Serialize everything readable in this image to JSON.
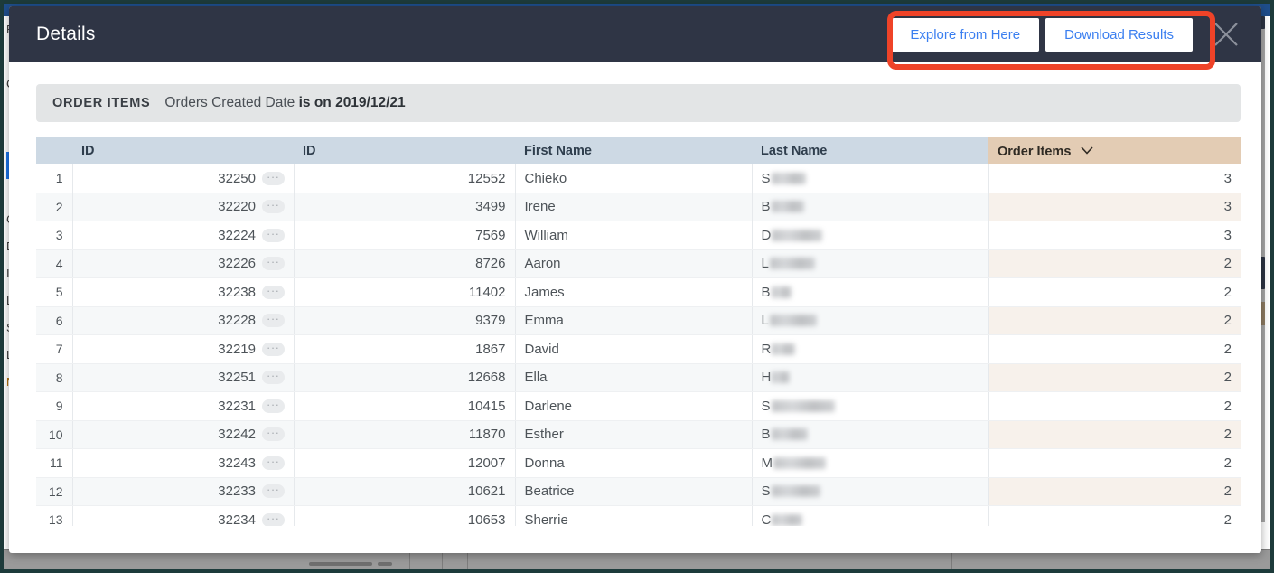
{
  "modal": {
    "title": "Details",
    "buttons": {
      "explore": "Explore from Here",
      "download": "Download Results"
    },
    "close_icon": "close-icon"
  },
  "filter": {
    "view_label": "ORDER ITEMS",
    "expression_prefix": "Orders Created Date ",
    "expression_value": "is on 2019/12/21"
  },
  "table": {
    "columns": [
      {
        "label": "",
        "key": "rownum"
      },
      {
        "label": "ID",
        "key": "order_id"
      },
      {
        "label": "ID",
        "key": "user_id"
      },
      {
        "label": "First Name",
        "key": "first_name"
      },
      {
        "label": "Last Name",
        "key": "last_name"
      },
      {
        "label": "Order Items",
        "key": "order_items",
        "sorted": true,
        "sort_icon": "chevron-down-icon"
      }
    ],
    "dots_label": "···",
    "rows": [
      {
        "rownum": "1",
        "order_id": "32250",
        "user_id": "12552",
        "first_name": "Chieko",
        "last_name_initial": "S",
        "redact_width": 38,
        "order_items": "3"
      },
      {
        "rownum": "2",
        "order_id": "32220",
        "user_id": "3499",
        "first_name": "Irene",
        "last_name_initial": "B",
        "redact_width": 36,
        "order_items": "3"
      },
      {
        "rownum": "3",
        "order_id": "32224",
        "user_id": "7569",
        "first_name": "William",
        "last_name_initial": "D",
        "redact_width": 56,
        "order_items": "3"
      },
      {
        "rownum": "4",
        "order_id": "32226",
        "user_id": "8726",
        "first_name": "Aaron",
        "last_name_initial": "L",
        "redact_width": 50,
        "order_items": "2"
      },
      {
        "rownum": "5",
        "order_id": "32238",
        "user_id": "11402",
        "first_name": "James",
        "last_name_initial": "B",
        "redact_width": 22,
        "order_items": "2"
      },
      {
        "rownum": "6",
        "order_id": "32228",
        "user_id": "9379",
        "first_name": "Emma",
        "last_name_initial": "L",
        "redact_width": 52,
        "order_items": "2"
      },
      {
        "rownum": "7",
        "order_id": "32219",
        "user_id": "1867",
        "first_name": "David",
        "last_name_initial": "R",
        "redact_width": 26,
        "order_items": "2"
      },
      {
        "rownum": "8",
        "order_id": "32251",
        "user_id": "12668",
        "first_name": "Ella",
        "last_name_initial": "H",
        "redact_width": 20,
        "order_items": "2"
      },
      {
        "rownum": "9",
        "order_id": "32231",
        "user_id": "10415",
        "first_name": "Darlene",
        "last_name_initial": "S",
        "redact_width": 70,
        "order_items": "2"
      },
      {
        "rownum": "10",
        "order_id": "32242",
        "user_id": "11870",
        "first_name": "Esther",
        "last_name_initial": "B",
        "redact_width": 40,
        "order_items": "2"
      },
      {
        "rownum": "11",
        "order_id": "32243",
        "user_id": "12007",
        "first_name": "Donna",
        "last_name_initial": "M",
        "redact_width": 58,
        "order_items": "2"
      },
      {
        "rownum": "12",
        "order_id": "32233",
        "user_id": "10621",
        "first_name": "Beatrice",
        "last_name_initial": "S",
        "redact_width": 54,
        "order_items": "2"
      },
      {
        "rownum": "13",
        "order_id": "32234",
        "user_id": "10653",
        "first_name": "Sherrie",
        "last_name_initial": "C",
        "redact_width": 34,
        "order_items": "2"
      }
    ]
  },
  "annotation": {
    "highlight_color": "#ef4328",
    "target": "header-action-buttons"
  },
  "background_app": {
    "sidebar_fragments": [
      "E",
      "C",
      "",
      "",
      "",
      "",
      "C",
      "D",
      "I",
      "L",
      "S",
      "L",
      "M"
    ]
  },
  "colors": {
    "header_bg": "#2f3545",
    "button_text": "#3b7ff0",
    "column_header_bg": "#cdd9e4",
    "sorted_column_header_bg": "#e3ccb4",
    "sorted_column_stripe": "#f7f1eb",
    "filter_bar_bg": "#e3e5e6"
  }
}
